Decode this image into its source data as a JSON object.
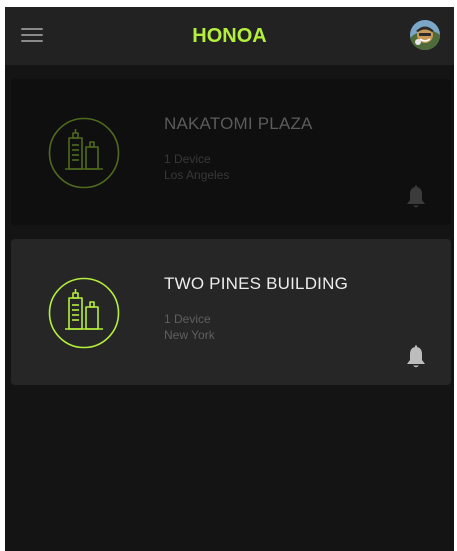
{
  "app": {
    "title": "HONOA"
  },
  "header": {
    "menu_icon": "hamburger-menu-icon",
    "avatar_icon": "user-avatar"
  },
  "buildings": [
    {
      "name": "NAKATOMI PLAZA",
      "devices": "1 Device",
      "city": "Los Angeles",
      "icon": "building-icon",
      "alert_icon": "bell-icon",
      "state": "inactive"
    },
    {
      "name": "TWO PINES BUILDING",
      "devices": "1 Device",
      "city": "New York",
      "icon": "building-icon",
      "alert_icon": "bell-icon",
      "state": "selected"
    }
  ],
  "colors": {
    "accent": "#b5ef3d",
    "accent_dim": "#5d7a22",
    "background": "#141414",
    "header": "#222222",
    "card_active": "#262626",
    "card_inactive": "#0f0f0f",
    "bell": "#bdbdbd"
  }
}
